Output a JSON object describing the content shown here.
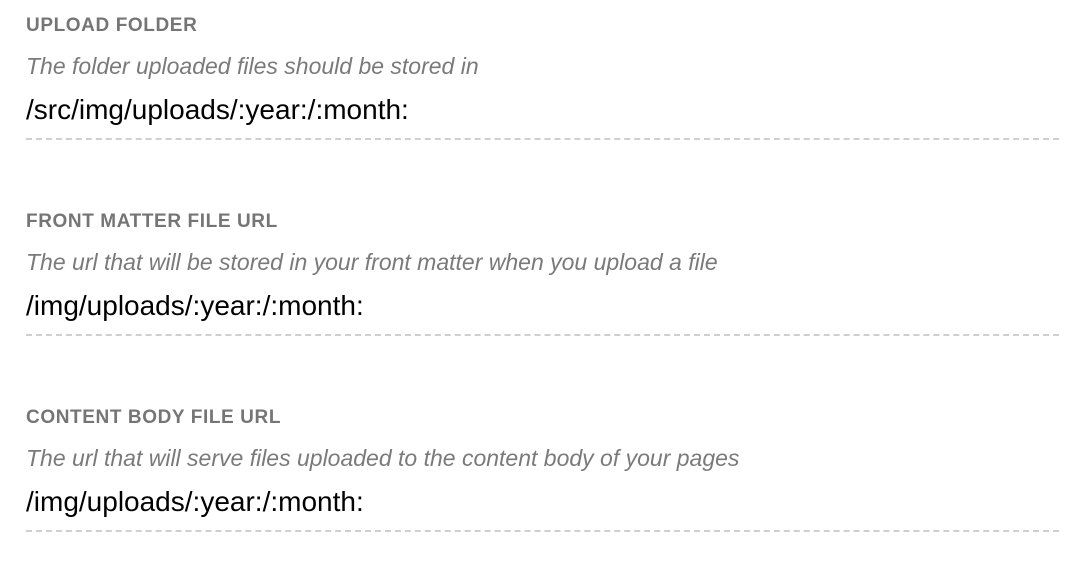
{
  "settings": {
    "upload_folder": {
      "label": "UPLOAD FOLDER",
      "description": "The folder uploaded files should be stored in",
      "value": "/src/img/uploads/:year:/:month:"
    },
    "front_matter_file_url": {
      "label": "FRONT MATTER FILE URL",
      "description": "The url that will be stored in your front matter when you upload a file",
      "value": "/img/uploads/:year:/:month:"
    },
    "content_body_file_url": {
      "label": "CONTENT BODY FILE URL",
      "description": "The url that will serve files uploaded to the content body of your pages",
      "value": "/img/uploads/:year:/:month:"
    }
  }
}
